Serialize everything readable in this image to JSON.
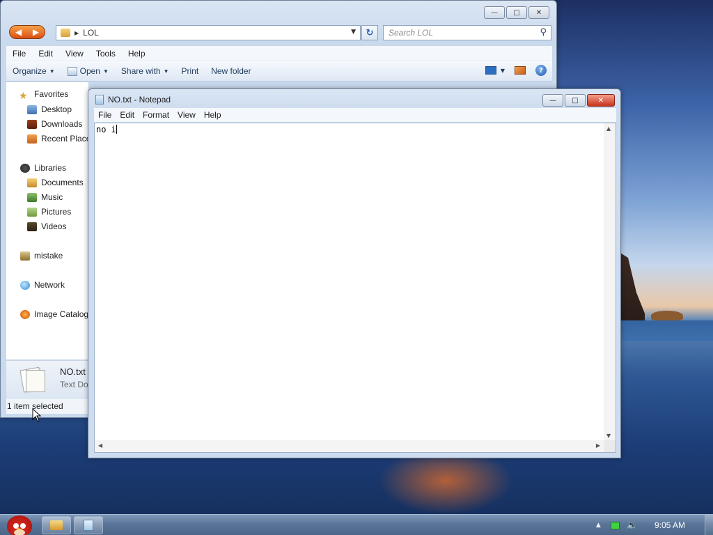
{
  "explorer": {
    "address_path": "LOL",
    "search_placeholder": "Search LOL",
    "menu": [
      "File",
      "Edit",
      "View",
      "Tools",
      "Help"
    ],
    "toolbar": {
      "organize": "Organize",
      "open": "Open",
      "share_with": "Share with",
      "print": "Print",
      "new_folder": "New folder"
    },
    "nav": {
      "favorites": "Favorites",
      "desktop": "Desktop",
      "downloads": "Downloads",
      "recent_places": "Recent Places",
      "libraries": "Libraries",
      "documents": "Documents",
      "music": "Music",
      "pictures": "Pictures",
      "videos": "Videos",
      "mistake": "mistake",
      "network": "Network",
      "image_catalog": "Image Catalog"
    },
    "details": {
      "file_name": "NO.txt",
      "file_type": "Text Document"
    },
    "status": "1 item selected"
  },
  "notepad": {
    "title": "NO.txt - Notepad",
    "menu": [
      "File",
      "Edit",
      "Format",
      "View",
      "Help"
    ],
    "content": "no i"
  },
  "taskbar": {
    "clock": "9:05 AM"
  },
  "colors": {
    "selection_accent": "#3a6fb5",
    "close_button": "#c8341c",
    "nav_button": "#e0621f"
  }
}
